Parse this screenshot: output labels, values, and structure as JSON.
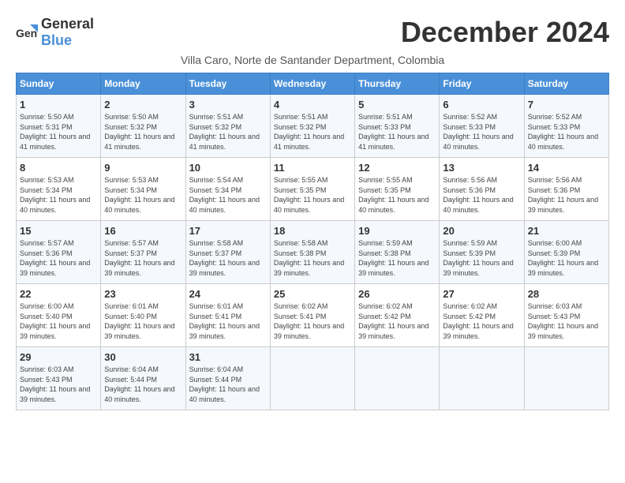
{
  "app": {
    "logo_general": "General",
    "logo_blue": "Blue"
  },
  "header": {
    "title": "December 2024",
    "location": "Villa Caro, Norte de Santander Department, Colombia"
  },
  "calendar": {
    "weekdays": [
      "Sunday",
      "Monday",
      "Tuesday",
      "Wednesday",
      "Thursday",
      "Friday",
      "Saturday"
    ],
    "weeks": [
      [
        {
          "day": "",
          "empty": true
        },
        {
          "day": "",
          "empty": true
        },
        {
          "day": "",
          "empty": true
        },
        {
          "day": "",
          "empty": true
        },
        {
          "day": "",
          "empty": true
        },
        {
          "day": "",
          "empty": true
        },
        {
          "day": "",
          "empty": true
        }
      ],
      [
        {
          "day": "1",
          "sunrise": "5:50 AM",
          "sunset": "5:31 PM",
          "daylight": "11 hours and 41 minutes."
        },
        {
          "day": "2",
          "sunrise": "5:50 AM",
          "sunset": "5:32 PM",
          "daylight": "11 hours and 41 minutes."
        },
        {
          "day": "3",
          "sunrise": "5:51 AM",
          "sunset": "5:32 PM",
          "daylight": "11 hours and 41 minutes."
        },
        {
          "day": "4",
          "sunrise": "5:51 AM",
          "sunset": "5:32 PM",
          "daylight": "11 hours and 41 minutes."
        },
        {
          "day": "5",
          "sunrise": "5:51 AM",
          "sunset": "5:33 PM",
          "daylight": "11 hours and 41 minutes."
        },
        {
          "day": "6",
          "sunrise": "5:52 AM",
          "sunset": "5:33 PM",
          "daylight": "11 hours and 40 minutes."
        },
        {
          "day": "7",
          "sunrise": "5:52 AM",
          "sunset": "5:33 PM",
          "daylight": "11 hours and 40 minutes."
        }
      ],
      [
        {
          "day": "8",
          "sunrise": "5:53 AM",
          "sunset": "5:34 PM",
          "daylight": "11 hours and 40 minutes."
        },
        {
          "day": "9",
          "sunrise": "5:53 AM",
          "sunset": "5:34 PM",
          "daylight": "11 hours and 40 minutes."
        },
        {
          "day": "10",
          "sunrise": "5:54 AM",
          "sunset": "5:34 PM",
          "daylight": "11 hours and 40 minutes."
        },
        {
          "day": "11",
          "sunrise": "5:55 AM",
          "sunset": "5:35 PM",
          "daylight": "11 hours and 40 minutes."
        },
        {
          "day": "12",
          "sunrise": "5:55 AM",
          "sunset": "5:35 PM",
          "daylight": "11 hours and 40 minutes."
        },
        {
          "day": "13",
          "sunrise": "5:56 AM",
          "sunset": "5:36 PM",
          "daylight": "11 hours and 40 minutes."
        },
        {
          "day": "14",
          "sunrise": "5:56 AM",
          "sunset": "5:36 PM",
          "daylight": "11 hours and 39 minutes."
        }
      ],
      [
        {
          "day": "15",
          "sunrise": "5:57 AM",
          "sunset": "5:36 PM",
          "daylight": "11 hours and 39 minutes."
        },
        {
          "day": "16",
          "sunrise": "5:57 AM",
          "sunset": "5:37 PM",
          "daylight": "11 hours and 39 minutes."
        },
        {
          "day": "17",
          "sunrise": "5:58 AM",
          "sunset": "5:37 PM",
          "daylight": "11 hours and 39 minutes."
        },
        {
          "day": "18",
          "sunrise": "5:58 AM",
          "sunset": "5:38 PM",
          "daylight": "11 hours and 39 minutes."
        },
        {
          "day": "19",
          "sunrise": "5:59 AM",
          "sunset": "5:38 PM",
          "daylight": "11 hours and 39 minutes."
        },
        {
          "day": "20",
          "sunrise": "5:59 AM",
          "sunset": "5:39 PM",
          "daylight": "11 hours and 39 minutes."
        },
        {
          "day": "21",
          "sunrise": "6:00 AM",
          "sunset": "5:39 PM",
          "daylight": "11 hours and 39 minutes."
        }
      ],
      [
        {
          "day": "22",
          "sunrise": "6:00 AM",
          "sunset": "5:40 PM",
          "daylight": "11 hours and 39 minutes."
        },
        {
          "day": "23",
          "sunrise": "6:01 AM",
          "sunset": "5:40 PM",
          "daylight": "11 hours and 39 minutes."
        },
        {
          "day": "24",
          "sunrise": "6:01 AM",
          "sunset": "5:41 PM",
          "daylight": "11 hours and 39 minutes."
        },
        {
          "day": "25",
          "sunrise": "6:02 AM",
          "sunset": "5:41 PM",
          "daylight": "11 hours and 39 minutes."
        },
        {
          "day": "26",
          "sunrise": "6:02 AM",
          "sunset": "5:42 PM",
          "daylight": "11 hours and 39 minutes."
        },
        {
          "day": "27",
          "sunrise": "6:02 AM",
          "sunset": "5:42 PM",
          "daylight": "11 hours and 39 minutes."
        },
        {
          "day": "28",
          "sunrise": "6:03 AM",
          "sunset": "5:43 PM",
          "daylight": "11 hours and 39 minutes."
        }
      ],
      [
        {
          "day": "29",
          "sunrise": "6:03 AM",
          "sunset": "5:43 PM",
          "daylight": "11 hours and 39 minutes."
        },
        {
          "day": "30",
          "sunrise": "6:04 AM",
          "sunset": "5:44 PM",
          "daylight": "11 hours and 40 minutes."
        },
        {
          "day": "31",
          "sunrise": "6:04 AM",
          "sunset": "5:44 PM",
          "daylight": "11 hours and 40 minutes."
        },
        {
          "day": "",
          "empty": true
        },
        {
          "day": "",
          "empty": true
        },
        {
          "day": "",
          "empty": true
        },
        {
          "day": "",
          "empty": true
        }
      ]
    ]
  }
}
